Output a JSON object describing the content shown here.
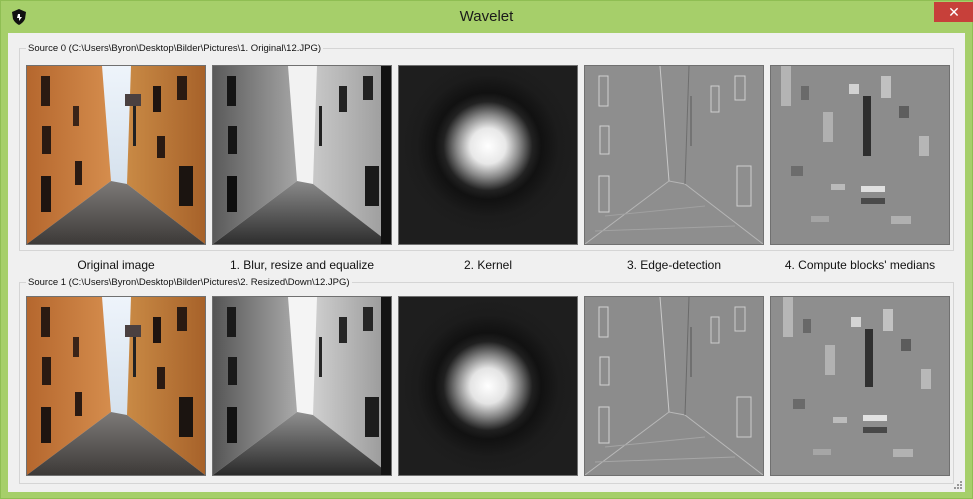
{
  "window": {
    "title": "Wavelet",
    "close_glyph": "✕",
    "icon": "shield-icon"
  },
  "sources": [
    {
      "label": "Source 0 (C:\\Users\\Byron\\Desktop\\Bilder\\Pictures\\1. Original\\12.JPG)"
    },
    {
      "label": "Source 1 (C:\\Users\\Byron\\Desktop\\Bilder\\Pictures\\2. Resized\\Down\\12.JPG)"
    }
  ],
  "captions": [
    "Original image",
    "1. Blur, resize and equalize",
    "2. Kernel",
    "3. Edge-detection",
    "4. Compute blocks' medians"
  ],
  "colors": {
    "title_bar": "#a6cf6a",
    "close_button": "#c7403a",
    "client_bg": "#f0f0f0"
  }
}
